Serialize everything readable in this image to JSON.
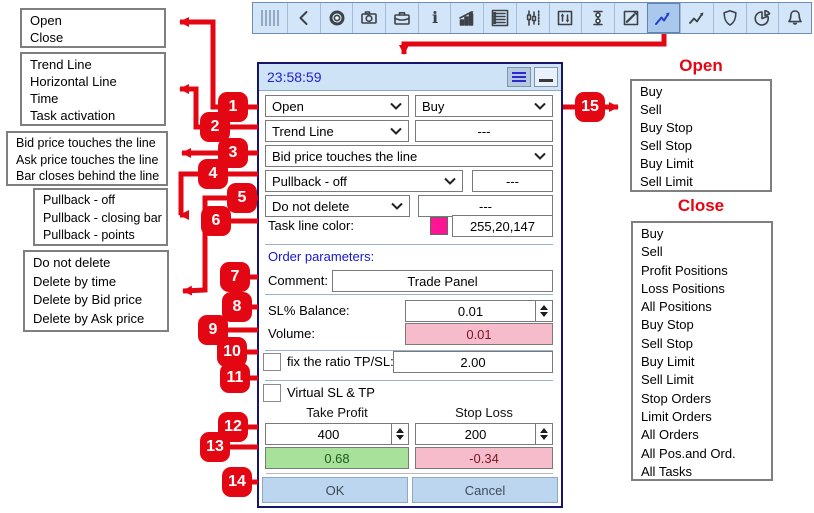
{
  "colors": {
    "accent_red": "#e30613",
    "task_line_color": "#ff1493",
    "pink_field_bg": "#f6bccb",
    "green_field_bg": "#a8e29a",
    "panel_title_bg": "#cfe3f7"
  },
  "toolbar": {
    "selected_icon": "trend-line-icon",
    "icons": [
      "chevron-left",
      "gear",
      "camera",
      "briefcase",
      "info",
      "bar-chart-arrow",
      "list",
      "candlesticks",
      "page-updown",
      "vertical-stretch",
      "note-edit",
      "trend-line",
      "zigzag-arrow",
      "shield",
      "pie-chart",
      "bell"
    ]
  },
  "panel": {
    "title": "23:58:59",
    "action_select": "Open",
    "direction_select": "Buy",
    "line_type_select": "Trend Line",
    "line_param_value": "---",
    "trigger_select": "Bid price touches the line",
    "pullback_select": "Pullback - off",
    "pullback_param_value": "---",
    "delete_select": "Do not delete",
    "delete_param_value": "---",
    "task_line_color_label": "Task line color:",
    "task_line_color_value": "255,20,147",
    "order_parameters_label": "Order parameters:",
    "comment_label": "Comment:",
    "comment_value": "Trade Panel",
    "sl_balance_label": "SL% Balance:",
    "sl_balance_value": "0.01",
    "volume_label": "Volume:",
    "volume_value": "0.01",
    "fix_ratio_label": "fix the ratio TP/SL:",
    "fix_ratio_value": "2.00",
    "virtual_label": "Virtual SL & TP",
    "take_profit_header": "Take Profit",
    "stop_loss_header": "Stop Loss",
    "take_profit_value": "400",
    "stop_loss_value": "200",
    "take_profit_result": "0.68",
    "stop_loss_result": "-0.34",
    "ok_label": "OK",
    "cancel_label": "Cancel"
  },
  "callouts": [
    "1",
    "2",
    "3",
    "4",
    "5",
    "6",
    "7",
    "8",
    "9",
    "10",
    "11",
    "12",
    "13",
    "14",
    "15"
  ],
  "option_boxes": {
    "action": {
      "items": [
        "Open",
        "Close"
      ]
    },
    "line_type": {
      "items": [
        "Trend Line",
        "Horizontal Line",
        "Time",
        "Task activation"
      ]
    },
    "trigger": {
      "items": [
        "Bid price touches the line",
        "Ask price touches the line",
        "Bar closes behind the line"
      ]
    },
    "pullback": {
      "items": [
        "Pullback - off",
        "Pullback - closing bar",
        "Pullback - points"
      ]
    },
    "delete": {
      "items": [
        "Do not delete",
        "Delete by time",
        "Delete by Bid price",
        "Delete by Ask price"
      ]
    }
  },
  "open_list": {
    "title": "Open",
    "items": [
      "Buy",
      "Sell",
      "Buy Stop",
      "Sell Stop",
      "Buy Limit",
      "Sell Limit"
    ]
  },
  "close_list": {
    "title": "Close",
    "items": [
      "Buy",
      "Sell",
      "Profit Positions",
      "Loss Positions",
      "All Positions",
      "Buy Stop",
      "Sell Stop",
      "Buy Limit",
      "Sell Limit",
      "Stop Orders",
      "Limit Orders",
      "All Orders",
      "All Pos.and Ord.",
      "All Tasks"
    ]
  }
}
